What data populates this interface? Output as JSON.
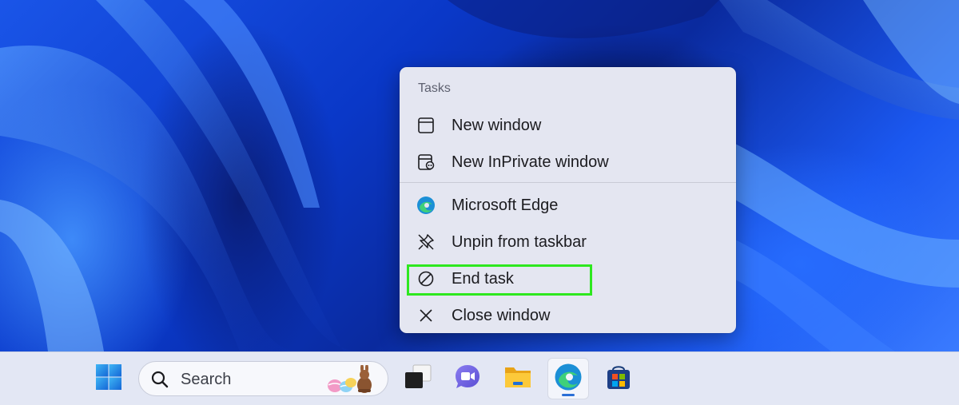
{
  "menu": {
    "header": "Tasks",
    "items": [
      {
        "label": "New window",
        "icon": "window-icon"
      },
      {
        "label": "New InPrivate window",
        "icon": "inprivate-window-icon"
      },
      {
        "label": "Microsoft Edge",
        "icon": "edge-icon"
      },
      {
        "label": "Unpin from taskbar",
        "icon": "unpin-icon"
      },
      {
        "label": "End task",
        "icon": "end-task-icon"
      },
      {
        "label": "Close window",
        "icon": "close-icon"
      }
    ],
    "highlighted_item": "End task",
    "highlight_color": "#2ee81f"
  },
  "taskbar": {
    "search_label": "Search",
    "apps": [
      "start-button",
      "task-view",
      "teams-chat",
      "file-explorer",
      "microsoft-edge",
      "microsoft-store"
    ],
    "active_app": "microsoft-edge"
  },
  "colors": {
    "menu_background": "#e4e6f1",
    "taskbar_background": "#e3e7f4",
    "wallpaper_accent": "#1a55e8"
  }
}
